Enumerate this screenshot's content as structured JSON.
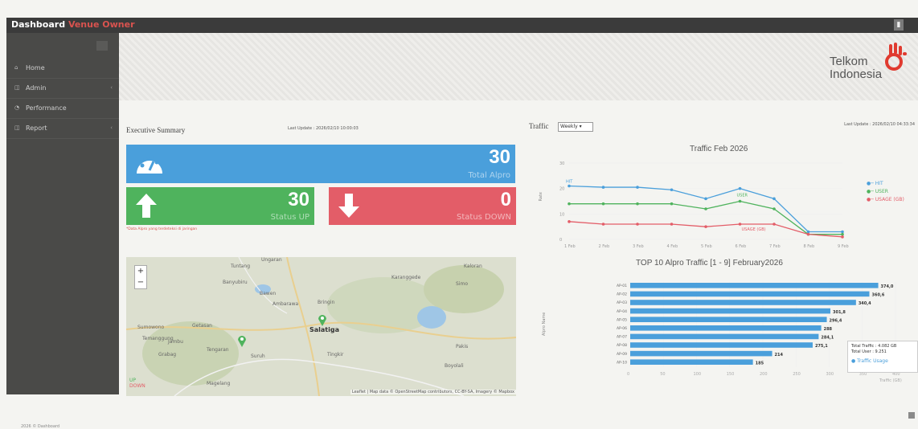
{
  "header": {
    "title": "Dashboard",
    "subtitle": "Venue Owner"
  },
  "sidebar": {
    "items": [
      {
        "icon": "home-icon",
        "label": "Home"
      },
      {
        "icon": "admin-icon",
        "label": "Admin"
      },
      {
        "icon": "performance-icon",
        "label": "Performance"
      },
      {
        "icon": "report-icon",
        "label": "Report"
      }
    ]
  },
  "logo": {
    "line1": "Telkom",
    "line2": "Indonesia",
    "color": "#e03a2f"
  },
  "summary": {
    "title": "Executive Summary",
    "last_update": "Last Update : 2026/02/10 10:00:03",
    "total_alpro": {
      "value": "30",
      "label": "Total Alpro"
    },
    "status_up": {
      "value": "30",
      "label": "Status UP"
    },
    "status_down": {
      "value": "0",
      "label": "Status DOWN"
    },
    "note": "*Data Alpro yang terdeteksi di jaringan"
  },
  "map": {
    "zoom_in": "+",
    "zoom_out": "−",
    "city": "Salatiga",
    "places": [
      "Ungaran",
      "Tuntang",
      "Bawen",
      "Ambarawa",
      "Bringin",
      "Getasan",
      "Tengaran",
      "Suruh",
      "Magelang",
      "Tingkir",
      "Karanggede",
      "Simo",
      "Banyubiru",
      "Sumowono",
      "Grabag",
      "Pakis",
      "Boyolali",
      "Temanggung",
      "Kaloran",
      "Jambu"
    ],
    "layer_labels": [
      "UP",
      "DOWN"
    ],
    "attribution": "Leaflet | Map data © OpenStreetMap contributors, CC-BY-SA, Imagery © Mapbox"
  },
  "traffic": {
    "label": "Traffic",
    "select_value": "Weekly",
    "last_update": "Last Update : 2026/02/10 04:33:34"
  },
  "chart_data": [
    {
      "type": "line",
      "title": "Traffic Feb 2026",
      "x": [
        "1 Feb",
        "2 Feb",
        "3 Feb",
        "4 Feb",
        "5 Feb",
        "6 Feb",
        "7 Feb",
        "8 Feb",
        "9 Feb"
      ],
      "ylabel": "Rate",
      "ylim": [
        0,
        30
      ],
      "series": [
        {
          "name": "HIT",
          "values": [
            21,
            20.5,
            20.5,
            19.5,
            16,
            20,
            16,
            3,
            3
          ],
          "color": "#4a9fdb"
        },
        {
          "name": "USER",
          "values": [
            14,
            14,
            14,
            14,
            12,
            15,
            12,
            2,
            2
          ],
          "color": "#4fb35d"
        },
        {
          "name": "USAGE (GB)",
          "values": [
            7,
            6,
            6,
            6,
            5,
            6,
            6,
            2,
            1
          ],
          "color": "#e35d68"
        }
      ],
      "annotations": [
        "HIT",
        "USER",
        "USAGE (GB)"
      ],
      "legend": "right"
    },
    {
      "type": "bar",
      "title": "TOP 10 Alpro Traffic [1 - 9] February2026",
      "orientation": "horizontal",
      "ylabel": "Alpro Name",
      "xlabel": "Traffic (GB)",
      "xlim": [
        0,
        400
      ],
      "categories": [
        "AP-01",
        "AP-02",
        "AP-03",
        "AP-04",
        "AP-05",
        "AP-06",
        "AP-07",
        "AP-08",
        "AP-09",
        "AP-10"
      ],
      "values": [
        374,
        360.6,
        340.4,
        301.8,
        296.4,
        288,
        284.1,
        275.1,
        214,
        185
      ],
      "data_labels": [
        "374,0",
        "360,6",
        "340,4",
        "301,8",
        "296,4",
        "288",
        "284,1",
        "275,1",
        "214",
        "185"
      ],
      "legend": [
        "Traffic Usage"
      ],
      "tooltip": [
        "Total Traffic : 4.082 GB",
        "Total User : 9.251"
      ],
      "color": "#4a9fdb"
    }
  ],
  "footer": "2026 © Dashboard"
}
